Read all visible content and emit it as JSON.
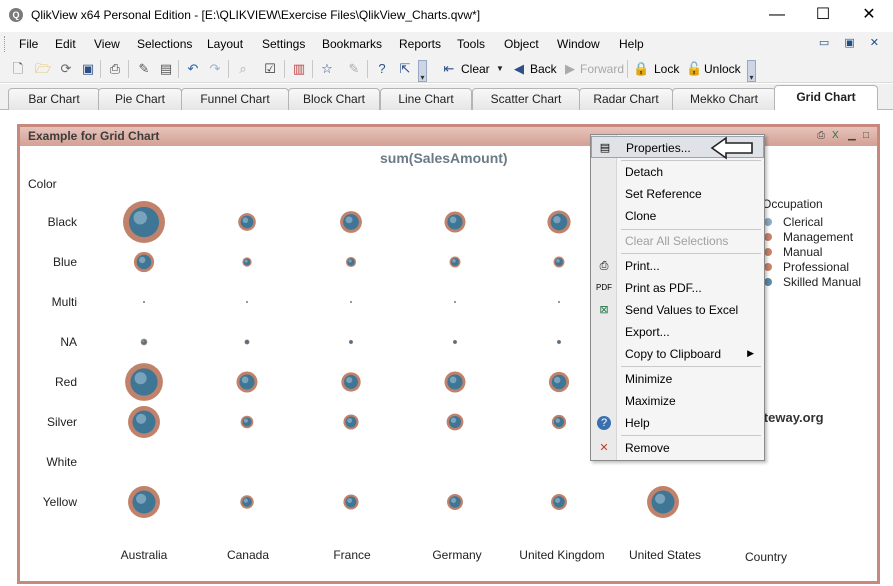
{
  "window": {
    "title": "QlikView x64 Personal Edition - [E:\\QLIKVIEW\\Exercise Files\\QlikView_Charts.qvw*]",
    "app_icon": "Q",
    "minimize": "—",
    "maximize": "☐",
    "close": "✕"
  },
  "menu": {
    "items": [
      "File",
      "Edit",
      "View",
      "Selections",
      "Layout",
      "Settings",
      "Bookmarks",
      "Reports",
      "Tools",
      "Object",
      "Window",
      "Help"
    ]
  },
  "toolbar": {
    "clear_label": "Clear",
    "back_label": "Back",
    "forward_label": "Forward",
    "lock_label": "Lock",
    "unlock_label": "Unlock"
  },
  "tabs": [
    {
      "label": "Bar Chart",
      "active": false
    },
    {
      "label": "Pie Chart",
      "active": false
    },
    {
      "label": "Funnel Chart",
      "active": false
    },
    {
      "label": "Block Chart",
      "active": false
    },
    {
      "label": "Line Chart",
      "active": false
    },
    {
      "label": "Scatter Chart",
      "active": false
    },
    {
      "label": "Radar Chart",
      "active": false
    },
    {
      "label": "Mekko Chart",
      "active": false
    },
    {
      "label": "Grid Chart",
      "active": true
    }
  ],
  "chart_object": {
    "caption": "Example for Grid Chart",
    "expression_title": "sum(SalesAmount)",
    "y_dimension_title": "Color",
    "x_dimension_title": "Country"
  },
  "chart_data": {
    "type": "grid",
    "title": "sum(SalesAmount)",
    "x_dimension": "Country",
    "y_dimension": "Color",
    "x_categories": [
      "Australia",
      "Canada",
      "France",
      "Germany",
      "United Kingdom",
      "United States"
    ],
    "y_categories": [
      "Black",
      "Blue",
      "Multi",
      "NA",
      "Red",
      "Silver",
      "White",
      "Yellow"
    ],
    "legend": {
      "title": "Occupation",
      "position": "right",
      "entries": [
        {
          "name": "Clerical",
          "color": "#8fa8c8"
        },
        {
          "name": "Management",
          "color": "#c8826a"
        },
        {
          "name": "Manual",
          "color": "#c8826a"
        },
        {
          "name": "Professional",
          "color": "#c8826a"
        },
        {
          "name": "Skilled Manual",
          "color": "#5a8aa6"
        }
      ]
    },
    "colors": {
      "bubble_outer": "#c0826a",
      "bubble_inner": "#3f7595",
      "bubble_highlight": "#a9c8dc"
    },
    "cells": [
      {
        "x": "Australia",
        "y": "Black",
        "size": 1.0
      },
      {
        "x": "Canada",
        "y": "Black",
        "size": 0.42
      },
      {
        "x": "France",
        "y": "Black",
        "size": 0.52
      },
      {
        "x": "Germany",
        "y": "Black",
        "size": 0.5
      },
      {
        "x": "United Kingdom",
        "y": "Black",
        "size": 0.55
      },
      {
        "x": "Australia",
        "y": "Blue",
        "size": 0.48
      },
      {
        "x": "Canada",
        "y": "Blue",
        "size": 0.22
      },
      {
        "x": "France",
        "y": "Blue",
        "size": 0.24
      },
      {
        "x": "Germany",
        "y": "Blue",
        "size": 0.26
      },
      {
        "x": "United Kingdom",
        "y": "Blue",
        "size": 0.26
      },
      {
        "x": "Australia",
        "y": "Multi",
        "size": 0.05
      },
      {
        "x": "Canada",
        "y": "Multi",
        "size": 0.04
      },
      {
        "x": "France",
        "y": "Multi",
        "size": 0.04
      },
      {
        "x": "Germany",
        "y": "Multi",
        "size": 0.04
      },
      {
        "x": "United Kingdom",
        "y": "Multi",
        "size": 0.04
      },
      {
        "x": "Australia",
        "y": "NA",
        "size": 0.16
      },
      {
        "x": "Canada",
        "y": "NA",
        "size": 0.12
      },
      {
        "x": "France",
        "y": "NA",
        "size": 0.1
      },
      {
        "x": "Germany",
        "y": "NA",
        "size": 0.1
      },
      {
        "x": "United Kingdom",
        "y": "NA",
        "size": 0.1
      },
      {
        "x": "Australia",
        "y": "Red",
        "size": 0.9
      },
      {
        "x": "Canada",
        "y": "Red",
        "size": 0.5
      },
      {
        "x": "France",
        "y": "Red",
        "size": 0.46
      },
      {
        "x": "Germany",
        "y": "Red",
        "size": 0.5
      },
      {
        "x": "United Kingdom",
        "y": "Red",
        "size": 0.48
      },
      {
        "x": "Australia",
        "y": "Silver",
        "size": 0.76
      },
      {
        "x": "Canada",
        "y": "Silver",
        "size": 0.3
      },
      {
        "x": "France",
        "y": "Silver",
        "size": 0.36
      },
      {
        "x": "Germany",
        "y": "Silver",
        "size": 0.4
      },
      {
        "x": "United Kingdom",
        "y": "Silver",
        "size": 0.34
      },
      {
        "x": "Australia",
        "y": "Yellow",
        "size": 0.76
      },
      {
        "x": "Canada",
        "y": "Yellow",
        "size": 0.32
      },
      {
        "x": "France",
        "y": "Yellow",
        "size": 0.36
      },
      {
        "x": "Germany",
        "y": "Yellow",
        "size": 0.38
      },
      {
        "x": "United Kingdom",
        "y": "Yellow",
        "size": 0.38
      },
      {
        "x": "United States",
        "y": "Yellow",
        "size": 0.76
      }
    ]
  },
  "context_menu": {
    "items": [
      {
        "label": "Properties...",
        "icon": "properties-icon",
        "highlighted": true,
        "disabled": false
      },
      {
        "label": "Detach",
        "icon": "",
        "highlighted": false,
        "disabled": false
      },
      {
        "label": "Set Reference",
        "icon": "",
        "highlighted": false,
        "disabled": false
      },
      {
        "label": "Clone",
        "icon": "",
        "highlighted": false,
        "disabled": false
      },
      {
        "label": "Clear All Selections",
        "icon": "",
        "highlighted": false,
        "disabled": true
      },
      {
        "label": "Print...",
        "icon": "print-icon",
        "highlighted": false,
        "disabled": false
      },
      {
        "label": "Print as PDF...",
        "icon": "pdf-icon",
        "highlighted": false,
        "disabled": false
      },
      {
        "label": "Send Values to Excel",
        "icon": "excel-icon",
        "highlighted": false,
        "disabled": false
      },
      {
        "label": "Export...",
        "icon": "",
        "highlighted": false,
        "disabled": false
      },
      {
        "label": "Copy to Clipboard",
        "icon": "",
        "highlighted": false,
        "disabled": false,
        "submenu": true
      },
      {
        "label": "Minimize",
        "icon": "",
        "highlighted": false,
        "disabled": false
      },
      {
        "label": "Maximize",
        "icon": "",
        "highlighted": false,
        "disabled": false
      },
      {
        "label": "Help",
        "icon": "help-icon",
        "highlighted": false,
        "disabled": false
      },
      {
        "label": "Remove",
        "icon": "remove-icon",
        "highlighted": false,
        "disabled": false
      }
    ]
  },
  "watermark": "©tutorialgateway.org"
}
